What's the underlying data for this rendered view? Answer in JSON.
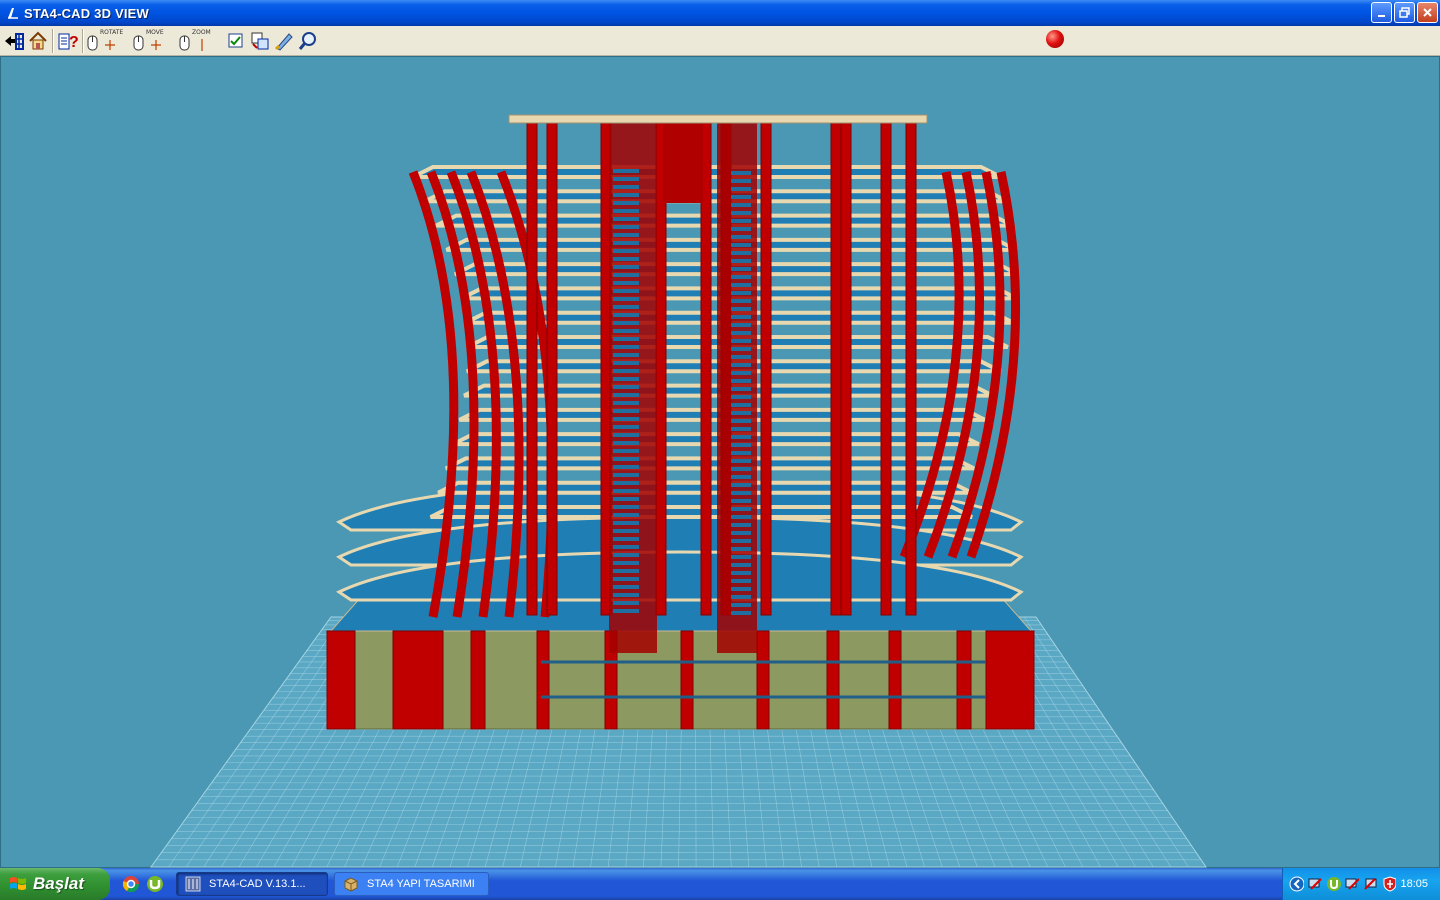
{
  "window": {
    "title": "STA4-CAD  3D VIEW"
  },
  "toolbar": {
    "rotate_label": "ROTATE",
    "move_label": "MOVE",
    "zoom_label": "ZOOM"
  },
  "colors": {
    "viewport_bg": "#4a98b3",
    "column_red": "#c00000",
    "slab_blue": "#1f7fb5",
    "beam_beige": "#e8d8b0",
    "basement_olive": "#8c9a62"
  },
  "taskbar": {
    "start_label": "Başlat",
    "tasks": [
      {
        "label": "STA4-CAD  V.13.1...",
        "active": true
      },
      {
        "label": "STA4 YAPI TASARIMI",
        "active": false
      }
    ],
    "clock": "18:05"
  }
}
